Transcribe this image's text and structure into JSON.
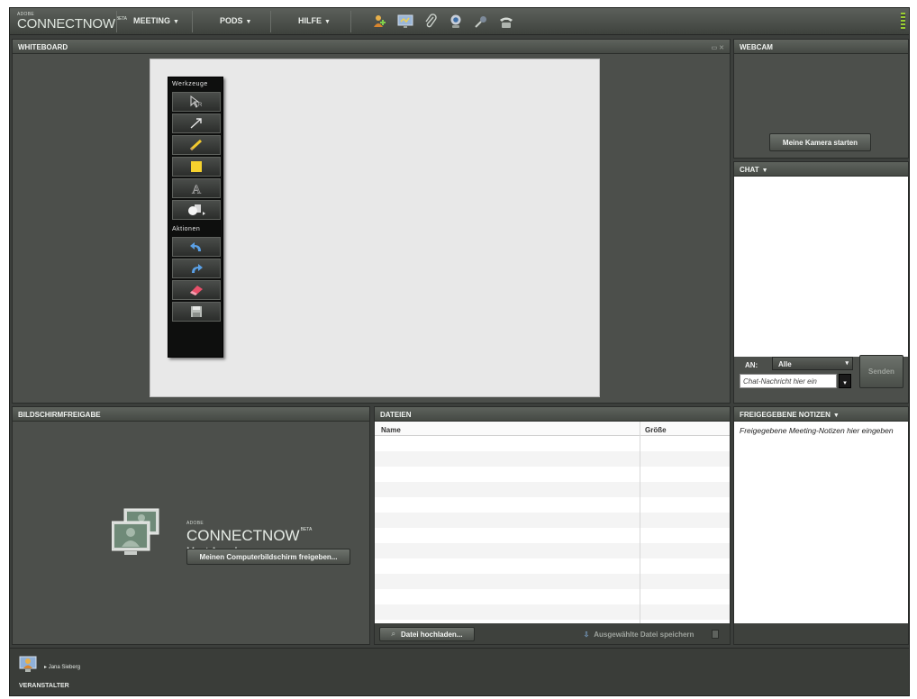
{
  "app": {
    "logo_adobe": "ADOBE",
    "logo_name": "CONNECTNOW",
    "logo_beta": "BETA"
  },
  "menu": [
    {
      "label": "MEETING"
    },
    {
      "label": "PODS"
    },
    {
      "label": "HILFE"
    }
  ],
  "toolbar_icons": [
    "add-user-icon",
    "screen-share-icon",
    "attach-file-icon",
    "webcam-icon",
    "microphone-icon",
    "telephone-icon"
  ],
  "whiteboard": {
    "title": "WHITEBOARD",
    "tools_header": "Werkzeuge",
    "tools": [
      "selection-tool-icon",
      "arrow-tool-icon",
      "pencil-tool-icon",
      "rectangle-tool-icon",
      "text-tool-icon",
      "shapes-tool-icon"
    ],
    "actions_header": "Aktionen",
    "actions": [
      "undo-icon",
      "redo-icon",
      "eraser-icon",
      "save-icon"
    ]
  },
  "webcam": {
    "title": "WEBCAM",
    "start_button": "Meine Kamera starten"
  },
  "chat": {
    "title": "CHAT",
    "to_label": "AN:",
    "recipient": "Alle",
    "placeholder": "Chat-Nachricht hier ein",
    "send_button": "Senden"
  },
  "screenshare": {
    "title": "BILDSCHIRMFREIGABE",
    "logo_adobe": "ADOBE",
    "logo_name": "CONNECTNOW",
    "logo_beta": "BETA",
    "tagline": "Meet Anywhere",
    "share_button": "Meinen Computerbildschirm freigeben..."
  },
  "files": {
    "title": "DATEIEN",
    "columns": [
      "Name",
      "Größe"
    ],
    "upload_button": "Datei hochladen...",
    "save_button": "Ausgewählte Datei speichern"
  },
  "notes": {
    "title": "FREIGEGEBENE NOTIZEN",
    "placeholder": "Freigegebene Meeting-Notizen hier eingeben"
  },
  "attendees": {
    "user": "Jana Sieberg",
    "role": "VERANSTALTER"
  },
  "colors": {
    "chrome_dark": "#3c3f3c",
    "pod_header": "#5e635d",
    "canvas": "#e8e8e8",
    "accent_green": "#9acd32"
  }
}
